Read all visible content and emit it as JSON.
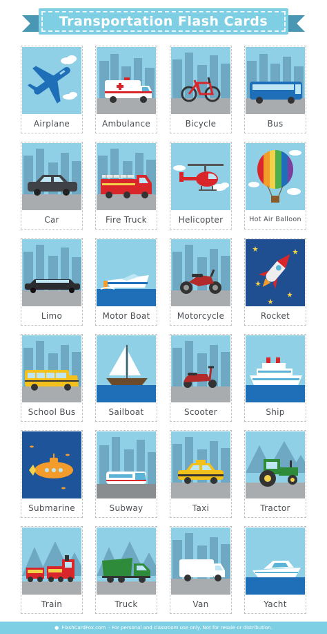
{
  "title": "Transportation Flash Cards",
  "cards": [
    {
      "label": "Airplane"
    },
    {
      "label": "Ambulance"
    },
    {
      "label": "Bicycle"
    },
    {
      "label": "Bus"
    },
    {
      "label": "Car"
    },
    {
      "label": "Fire Truck"
    },
    {
      "label": "Helicopter"
    },
    {
      "label": "Hot Air Balloon"
    },
    {
      "label": "Limo"
    },
    {
      "label": "Motor Boat"
    },
    {
      "label": "Motorcycle"
    },
    {
      "label": "Rocket"
    },
    {
      "label": "School Bus"
    },
    {
      "label": "Sailboat"
    },
    {
      "label": "Scooter"
    },
    {
      "label": "Ship"
    },
    {
      "label": "Submarine"
    },
    {
      "label": "Subway"
    },
    {
      "label": "Taxi"
    },
    {
      "label": "Tractor"
    },
    {
      "label": "Train"
    },
    {
      "label": "Truck"
    },
    {
      "label": "Van"
    },
    {
      "label": "Yacht"
    }
  ],
  "footer": {
    "site": "FlashCardFox.com",
    "notice": "- For personal and classroom use only. Not for resale or distribution."
  },
  "colors": {
    "sky": "#8fd0e6",
    "building": "#6ea8c2",
    "road": "#a9acae",
    "sea": "#1f6fb8",
    "space": "#1f4f91",
    "banner": "#7ecfe3"
  }
}
